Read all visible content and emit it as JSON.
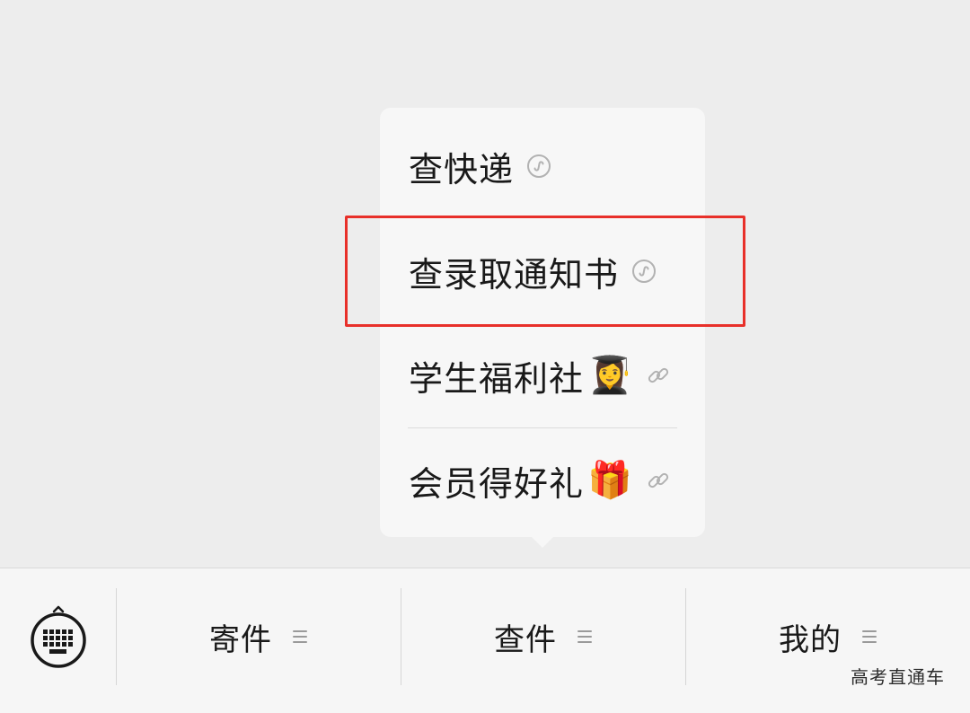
{
  "popup_menu": {
    "items": [
      {
        "label": "查快递",
        "emoji": "",
        "icon": "mini-program-icon"
      },
      {
        "label": "查录取通知书",
        "emoji": "",
        "icon": "mini-program-icon"
      },
      {
        "label": "学生福利社",
        "emoji": "👩‍🎓",
        "icon": "link-icon"
      },
      {
        "label": "会员得好礼",
        "emoji": "🎁",
        "icon": "link-icon"
      }
    ],
    "highlighted_item": "查录取通知书"
  },
  "bottom_bar": {
    "keyboard_icon": "keyboard-icon",
    "tabs": [
      {
        "label": "寄件",
        "icon": "menu-lines-icon"
      },
      {
        "label": "查件",
        "icon": "menu-lines-icon"
      },
      {
        "label": "我的",
        "icon": "menu-lines-icon"
      }
    ]
  },
  "watermark": "高考直通车",
  "colors": {
    "background": "#ededed",
    "popup": "#f7f7f7",
    "highlight": "#e8302a",
    "text": "#191919",
    "icon_gray": "#b2b2b2"
  }
}
